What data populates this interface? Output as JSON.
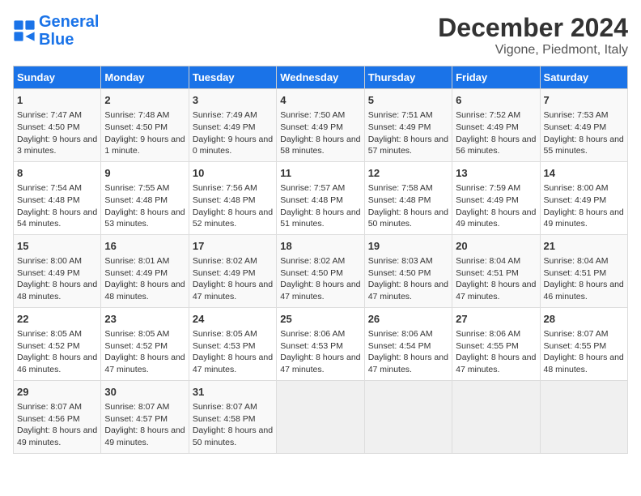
{
  "header": {
    "logo_line1": "General",
    "logo_line2": "Blue",
    "title": "December 2024",
    "subtitle": "Vigone, Piedmont, Italy"
  },
  "days_of_week": [
    "Sunday",
    "Monday",
    "Tuesday",
    "Wednesday",
    "Thursday",
    "Friday",
    "Saturday"
  ],
  "weeks": [
    [
      {
        "day": "1",
        "sunrise": "7:47 AM",
        "sunset": "4:50 PM",
        "daylight": "9 hours and 3 minutes."
      },
      {
        "day": "2",
        "sunrise": "7:48 AM",
        "sunset": "4:50 PM",
        "daylight": "9 hours and 1 minute."
      },
      {
        "day": "3",
        "sunrise": "7:49 AM",
        "sunset": "4:49 PM",
        "daylight": "9 hours and 0 minutes."
      },
      {
        "day": "4",
        "sunrise": "7:50 AM",
        "sunset": "4:49 PM",
        "daylight": "8 hours and 58 minutes."
      },
      {
        "day": "5",
        "sunrise": "7:51 AM",
        "sunset": "4:49 PM",
        "daylight": "8 hours and 57 minutes."
      },
      {
        "day": "6",
        "sunrise": "7:52 AM",
        "sunset": "4:49 PM",
        "daylight": "8 hours and 56 minutes."
      },
      {
        "day": "7",
        "sunrise": "7:53 AM",
        "sunset": "4:49 PM",
        "daylight": "8 hours and 55 minutes."
      }
    ],
    [
      {
        "day": "8",
        "sunrise": "7:54 AM",
        "sunset": "4:48 PM",
        "daylight": "8 hours and 54 minutes."
      },
      {
        "day": "9",
        "sunrise": "7:55 AM",
        "sunset": "4:48 PM",
        "daylight": "8 hours and 53 minutes."
      },
      {
        "day": "10",
        "sunrise": "7:56 AM",
        "sunset": "4:48 PM",
        "daylight": "8 hours and 52 minutes."
      },
      {
        "day": "11",
        "sunrise": "7:57 AM",
        "sunset": "4:48 PM",
        "daylight": "8 hours and 51 minutes."
      },
      {
        "day": "12",
        "sunrise": "7:58 AM",
        "sunset": "4:48 PM",
        "daylight": "8 hours and 50 minutes."
      },
      {
        "day": "13",
        "sunrise": "7:59 AM",
        "sunset": "4:49 PM",
        "daylight": "8 hours and 49 minutes."
      },
      {
        "day": "14",
        "sunrise": "8:00 AM",
        "sunset": "4:49 PM",
        "daylight": "8 hours and 49 minutes."
      }
    ],
    [
      {
        "day": "15",
        "sunrise": "8:00 AM",
        "sunset": "4:49 PM",
        "daylight": "8 hours and 48 minutes."
      },
      {
        "day": "16",
        "sunrise": "8:01 AM",
        "sunset": "4:49 PM",
        "daylight": "8 hours and 48 minutes."
      },
      {
        "day": "17",
        "sunrise": "8:02 AM",
        "sunset": "4:49 PM",
        "daylight": "8 hours and 47 minutes."
      },
      {
        "day": "18",
        "sunrise": "8:02 AM",
        "sunset": "4:50 PM",
        "daylight": "8 hours and 47 minutes."
      },
      {
        "day": "19",
        "sunrise": "8:03 AM",
        "sunset": "4:50 PM",
        "daylight": "8 hours and 47 minutes."
      },
      {
        "day": "20",
        "sunrise": "8:04 AM",
        "sunset": "4:51 PM",
        "daylight": "8 hours and 47 minutes."
      },
      {
        "day": "21",
        "sunrise": "8:04 AM",
        "sunset": "4:51 PM",
        "daylight": "8 hours and 46 minutes."
      }
    ],
    [
      {
        "day": "22",
        "sunrise": "8:05 AM",
        "sunset": "4:52 PM",
        "daylight": "8 hours and 46 minutes."
      },
      {
        "day": "23",
        "sunrise": "8:05 AM",
        "sunset": "4:52 PM",
        "daylight": "8 hours and 47 minutes."
      },
      {
        "day": "24",
        "sunrise": "8:05 AM",
        "sunset": "4:53 PM",
        "daylight": "8 hours and 47 minutes."
      },
      {
        "day": "25",
        "sunrise": "8:06 AM",
        "sunset": "4:53 PM",
        "daylight": "8 hours and 47 minutes."
      },
      {
        "day": "26",
        "sunrise": "8:06 AM",
        "sunset": "4:54 PM",
        "daylight": "8 hours and 47 minutes."
      },
      {
        "day": "27",
        "sunrise": "8:06 AM",
        "sunset": "4:55 PM",
        "daylight": "8 hours and 47 minutes."
      },
      {
        "day": "28",
        "sunrise": "8:07 AM",
        "sunset": "4:55 PM",
        "daylight": "8 hours and 48 minutes."
      }
    ],
    [
      {
        "day": "29",
        "sunrise": "8:07 AM",
        "sunset": "4:56 PM",
        "daylight": "8 hours and 49 minutes."
      },
      {
        "day": "30",
        "sunrise": "8:07 AM",
        "sunset": "4:57 PM",
        "daylight": "8 hours and 49 minutes."
      },
      {
        "day": "31",
        "sunrise": "8:07 AM",
        "sunset": "4:58 PM",
        "daylight": "8 hours and 50 minutes."
      },
      null,
      null,
      null,
      null
    ]
  ]
}
